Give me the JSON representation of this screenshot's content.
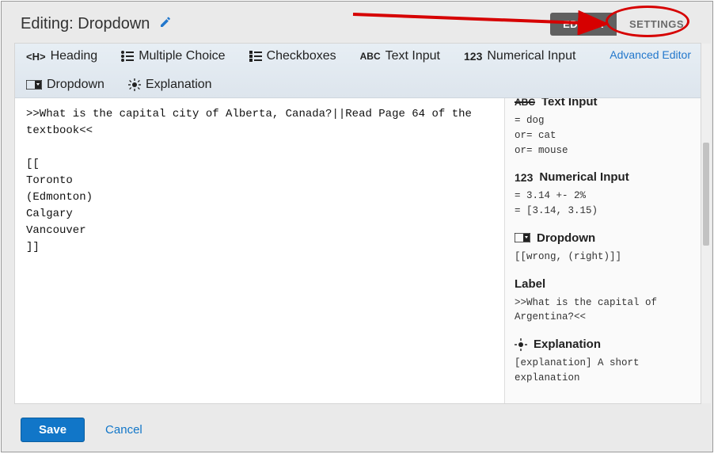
{
  "header": {
    "title": "Editing: Dropdown"
  },
  "tabs": {
    "editor": "EDITOR",
    "settings": "SETTINGS"
  },
  "toolbar": {
    "heading": "Heading",
    "multiple_choice": "Multiple Choice",
    "checkboxes": "Checkboxes",
    "text_input": "Text Input",
    "numerical_input": "Numerical Input",
    "dropdown": "Dropdown",
    "explanation": "Explanation",
    "advanced": "Advanced Editor"
  },
  "editor_text": ">>What is the capital city of Alberta, Canada?||Read Page 64 of the textbook<<\n\n[[\nToronto\n(Edmonton)\nCalgary\nVancouver\n]]",
  "help": {
    "text_input_title": "Text Input",
    "text_input_code": "= dog\nor= cat\nor= mouse",
    "numerical_title": "Numerical Input",
    "numerical_code": "= 3.14 +- 2%\n= [3.14, 3.15)",
    "dropdown_title": "Dropdown",
    "dropdown_code": "[[wrong, (right)]]",
    "label_title": "Label",
    "label_code": ">>What is the capital of Argentina?<<",
    "explanation_title": "Explanation",
    "explanation_code": "[explanation] A short explanation"
  },
  "footer": {
    "save": "Save",
    "cancel": "Cancel"
  }
}
